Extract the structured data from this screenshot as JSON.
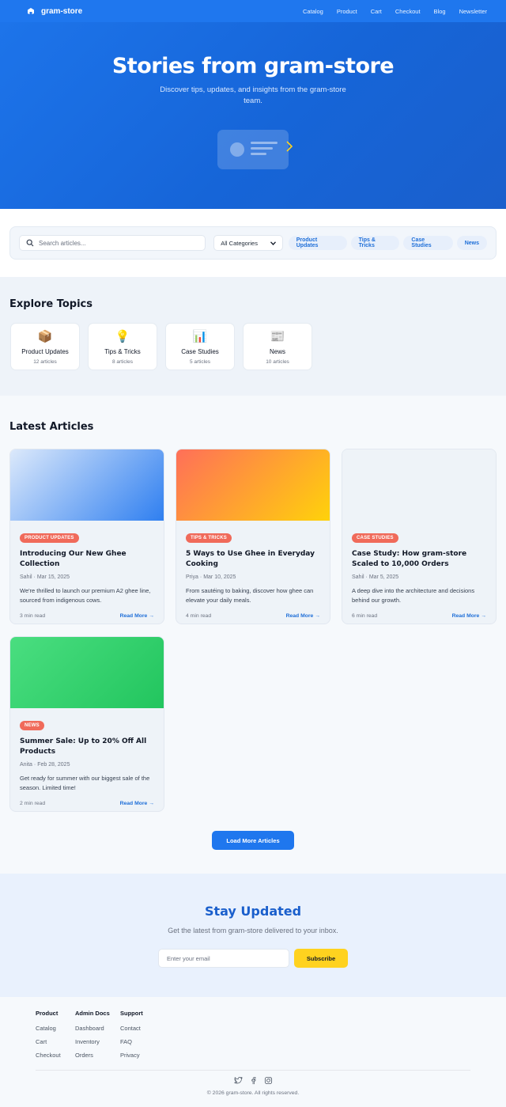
{
  "nav": {
    "brand": "gram-store",
    "links": [
      "Catalog",
      "Product",
      "Cart",
      "Checkout",
      "Blog",
      "Newsletter"
    ]
  },
  "hero": {
    "title": "Stories from gram-store",
    "subtitle": "Discover tips, updates, and insights from the gram-store team."
  },
  "filter": {
    "search_placeholder": "Search articles...",
    "category_selected": "All Categories",
    "pills": [
      "Product Updates",
      "Tips & Tricks",
      "Case Studies",
      "News"
    ]
  },
  "topics": {
    "title": "Explore Topics",
    "items": [
      {
        "icon": "📦",
        "icon_name": "package-icon",
        "name": "Product Updates",
        "count": "12 articles"
      },
      {
        "icon": "💡",
        "icon_name": "lightbulb-icon",
        "name": "Tips & Tricks",
        "count": "8 articles"
      },
      {
        "icon": "📊",
        "icon_name": "bar-chart-icon",
        "name": "Case Studies",
        "count": "5 articles"
      },
      {
        "icon": "📰",
        "icon_name": "newspaper-icon",
        "name": "News",
        "count": "10 articles"
      }
    ]
  },
  "articles": {
    "title": "Latest Articles",
    "items": [
      {
        "tag": "PRODUCT UPDATES",
        "title": "Introducing Our New Ghee Collection",
        "author": "Sahil",
        "date": "Mar 15, 2025",
        "excerpt": "We're thrilled to launch our premium A2 ghee line, sourced from indigenous cows.",
        "read_time": "3 min read",
        "read_more": "Read More →",
        "gradient_from": "#dce9fb",
        "gradient_to": "#2f7ff0"
      },
      {
        "tag": "TIPS & TRICKS",
        "title": "5 Ways to Use Ghee in Everyday Cooking",
        "author": "Priya",
        "date": "Mar 10, 2025",
        "excerpt": "From sautéing to baking, discover how ghee can elevate your daily meals.",
        "read_time": "4 min read",
        "read_more": "Read More →",
        "gradient_from": "#ff6f59",
        "gradient_to": "#ffd20a"
      },
      {
        "tag": "CASE STUDIES",
        "title": "Case Study: How gram-store Scaled to 10,000 Orders",
        "author": "Sahil",
        "date": "Mar 5, 2025",
        "excerpt": "A deep dive into the architecture and decisions behind our growth.",
        "read_time": "6 min read",
        "read_more": "Read More →",
        "gradient_from": "#eef3f8",
        "gradient_to": "#eef3f8"
      },
      {
        "tag": "NEWS",
        "title": "Summer Sale: Up to 20% Off All Products",
        "author": "Anita",
        "date": "Feb 28, 2025",
        "excerpt": "Get ready for summer with our biggest sale of the season. Limited time!",
        "read_time": "2 min read",
        "read_more": "Read More →",
        "gradient_from": "#4ade80",
        "gradient_to": "#22c55e"
      }
    ],
    "load_more": "Load More Articles"
  },
  "newsletter": {
    "title": "Stay Updated",
    "subtitle": "Get the latest from gram-store delivered to your inbox.",
    "email_placeholder": "Enter your email",
    "button": "Subscribe"
  },
  "footer": {
    "columns": [
      {
        "heading": "Product",
        "links": [
          "Catalog",
          "Cart",
          "Checkout"
        ]
      },
      {
        "heading": "Admin Docs",
        "links": [
          "Dashboard",
          "Inventory",
          "Orders"
        ]
      },
      {
        "heading": "Support",
        "links": [
          "Contact",
          "FAQ",
          "Privacy"
        ]
      }
    ],
    "social": [
      "twitter-icon",
      "facebook-icon",
      "instagram-icon"
    ],
    "copyright": "© 2026 gram-store. All rights reserved."
  },
  "colors": {
    "primary": "#1f77ee",
    "accent": "#ffd21f",
    "tag": "#f06a5a"
  }
}
